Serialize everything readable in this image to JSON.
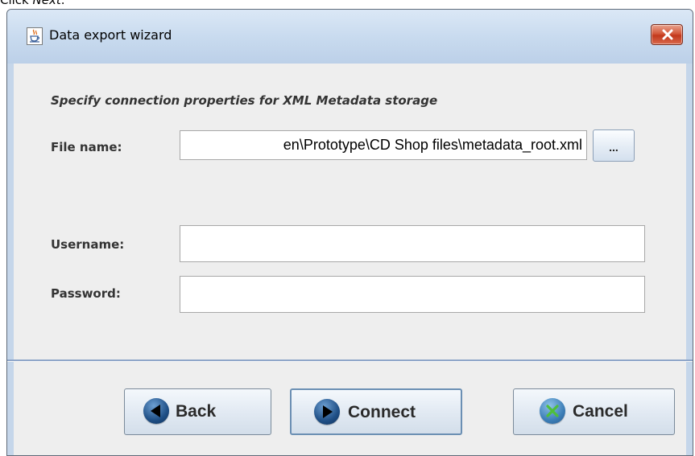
{
  "caption": {
    "prefix": "Click ",
    "emphasis": "Next",
    "suffix": "."
  },
  "window": {
    "title": "Data export wizard"
  },
  "form": {
    "heading": "Specify connection properties for XML Metadata storage",
    "file_name_label": "File name:",
    "file_name_value": "en\\Prototype\\CD Shop files\\metadata_root.xml",
    "browse_label": "...",
    "username_label": "Username:",
    "username_value": "",
    "password_label": "Password:",
    "password_value": ""
  },
  "buttons": {
    "back": "Back",
    "connect": "Connect",
    "cancel": "Cancel"
  },
  "icons": {
    "app": "java-cup-icon",
    "close": "close-icon",
    "back": "arrow-left-icon",
    "connect": "arrow-right-icon",
    "cancel": "cancel-x-icon"
  },
  "colors": {
    "titlebar": "#c9dbef",
    "close_button": "#c8452a",
    "panel": "#eeeeee",
    "separator": "#8fa6c9",
    "nav_icon": "#1f4f86",
    "cancel_icon_x": "#4fbf3a"
  }
}
